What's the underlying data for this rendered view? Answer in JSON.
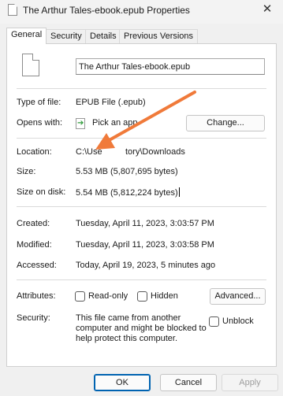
{
  "window": {
    "title": "The Arthur Tales-ebook.epub Properties",
    "close_glyph": "✕"
  },
  "tabs": [
    {
      "label": "General",
      "active": true
    },
    {
      "label": "Security",
      "active": false
    },
    {
      "label": "Details",
      "active": false
    },
    {
      "label": "Previous Versions",
      "active": false
    }
  ],
  "general": {
    "file_name": "The Arthur Tales-ebook.epub",
    "type_label": "Type of file:",
    "type_value": "EPUB File (.epub)",
    "opens_label": "Opens with:",
    "opens_value": "Pick an app",
    "change_button": "Change...",
    "location_label": "Location:",
    "location_value": "C:\\Users\\...tory\\Downloads",
    "location_visible_left": "C:\\Use",
    "location_visible_right": "tory\\Downloads",
    "size_label": "Size:",
    "size_value": "5.53 MB (5,807,695 bytes)",
    "size_on_disk_label": "Size on disk:",
    "size_on_disk_value": "5.54 MB (5,812,224 bytes)",
    "created_label": "Created:",
    "created_value": "Tuesday, April 11, 2023, 3:03:57 PM",
    "modified_label": "Modified:",
    "modified_value": "Tuesday, April 11, 2023, 3:03:58 PM",
    "accessed_label": "Accessed:",
    "accessed_value": "Today, April 19, 2023, 5 minutes ago",
    "attributes_label": "Attributes:",
    "readonly_label": "Read-only",
    "readonly_checked": false,
    "hidden_label": "Hidden",
    "hidden_checked": false,
    "advanced_button": "Advanced...",
    "security_label": "Security:",
    "security_line1": "This file came from another",
    "security_line2": "computer and might be blocked to",
    "security_line3": "help protect this computer.",
    "unblock_label": "Unblock",
    "unblock_checked": false
  },
  "footer": {
    "ok": "OK",
    "cancel": "Cancel",
    "apply": "Apply"
  },
  "annotation": {
    "arrow_color": "#f07a3a"
  }
}
